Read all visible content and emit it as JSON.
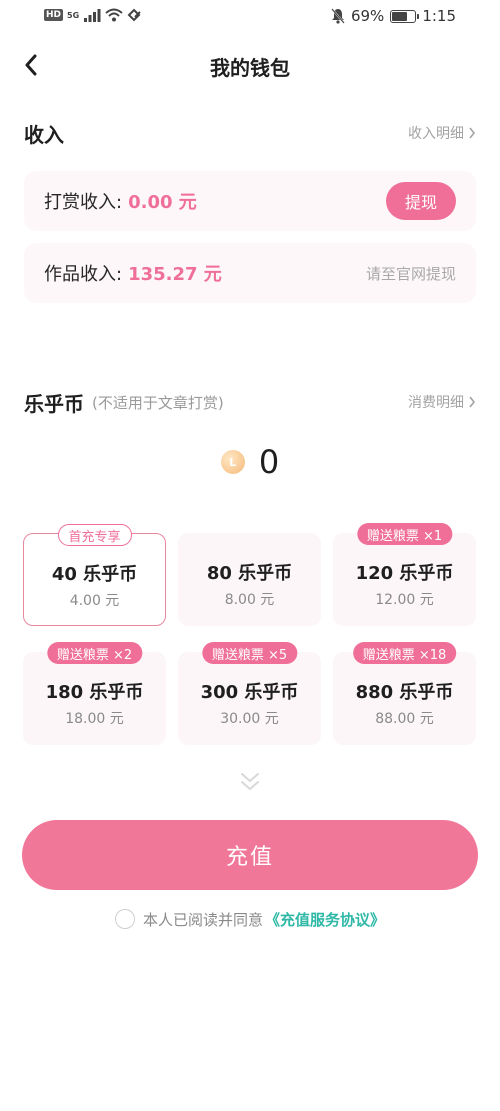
{
  "status_bar": {
    "hd": "HD",
    "network": "5G",
    "battery_level": 69,
    "battery_text": "69%",
    "time": "1:15"
  },
  "nav": {
    "title": "我的钱包"
  },
  "income": {
    "title": "收入",
    "link": "收入明细",
    "tips": {
      "label": "打赏收入:",
      "value": "0.00 元",
      "button": "提现"
    },
    "works": {
      "label": "作品收入:",
      "value": "135.27 元",
      "note": "请至官网提现"
    }
  },
  "coins": {
    "title": "乐乎币",
    "subtitle": "(不适用于文章打赏)",
    "link": "消费明细",
    "coin_letter": "L",
    "balance": "0"
  },
  "packages": [
    {
      "amount": "40 乐乎币",
      "price": "4.00 元",
      "badge": "首充专享",
      "badge_style": "outline",
      "selected": true
    },
    {
      "amount": "80 乐乎币",
      "price": "8.00 元",
      "badge": "",
      "badge_style": "",
      "selected": false
    },
    {
      "amount": "120 乐乎币",
      "price": "12.00 元",
      "badge": "赠送粮票 ×1",
      "badge_style": "filled",
      "selected": false
    },
    {
      "amount": "180 乐乎币",
      "price": "18.00 元",
      "badge": "赠送粮票 ×2",
      "badge_style": "filled",
      "selected": false
    },
    {
      "amount": "300 乐乎币",
      "price": "30.00 元",
      "badge": "赠送粮票 ×5",
      "badge_style": "filled",
      "selected": false
    },
    {
      "amount": "880 乐乎币",
      "price": "88.00 元",
      "badge": "赠送粮票 ×18",
      "badge_style": "filled",
      "selected": false
    }
  ],
  "recharge": {
    "button": "充值"
  },
  "agreement": {
    "text": "本人已阅读并同意",
    "link": "《充值服务协议》",
    "checked": false
  },
  "colors": {
    "accent": "#ef6f98",
    "link": "#2fb8a6",
    "card_bg": "#fdf7fa"
  }
}
